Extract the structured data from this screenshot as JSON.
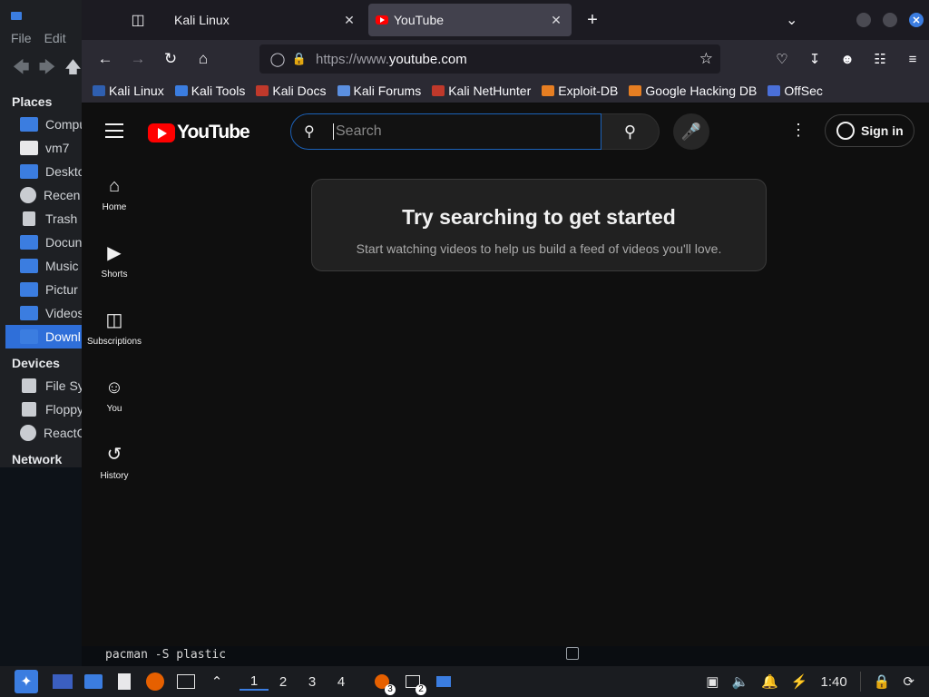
{
  "file_manager": {
    "menu": [
      "File",
      "Edit"
    ],
    "places_header": "Places",
    "places": [
      "Compu",
      "vm7",
      "Deskto",
      "Recen",
      "Trash",
      "Docun",
      "Music",
      "Pictur",
      "Videos",
      "Downl"
    ],
    "devices_header": "Devices",
    "devices": [
      "File Sy",
      "Floppy",
      "ReactO"
    ],
    "network_header": "Network"
  },
  "terminal": {
    "command": "pacman -S plastic"
  },
  "browser": {
    "tabs": [
      {
        "title": "Kali Linux",
        "active": false
      },
      {
        "title": "YouTube",
        "active": true
      }
    ],
    "url": {
      "prefix": "https://www.",
      "domain": "youtube.com"
    },
    "bookmarks": [
      {
        "label": "Kali Linux",
        "color": "#2f5fb0"
      },
      {
        "label": "Kali Tools",
        "color": "#3b7de0"
      },
      {
        "label": "Kali Docs",
        "color": "#c0392b"
      },
      {
        "label": "Kali Forums",
        "color": "#5b8fe0"
      },
      {
        "label": "Kali NetHunter",
        "color": "#c0392b"
      },
      {
        "label": "Exploit-DB",
        "color": "#e67e22"
      },
      {
        "label": "Google Hacking DB",
        "color": "#e67e22"
      },
      {
        "label": "OffSec",
        "color": "#4a6fd8"
      }
    ]
  },
  "youtube": {
    "logo_text": "YouTube",
    "search_placeholder": "Search",
    "sign_in": "Sign in",
    "guide": [
      {
        "label": "Home",
        "icon": "home-icon"
      },
      {
        "label": "Shorts",
        "icon": "shorts-icon"
      },
      {
        "label": "Subscriptions",
        "icon": "subscriptions-icon"
      },
      {
        "label": "You",
        "icon": "you-icon"
      },
      {
        "label": "History",
        "icon": "history-icon"
      }
    ],
    "prompt_title": "Try searching to get started",
    "prompt_body": "Start watching videos to help us build a feed of videos you'll love."
  },
  "taskbar": {
    "workspaces": [
      "1",
      "2",
      "3",
      "4"
    ],
    "badges": [
      "3",
      "2"
    ],
    "clock": "1:40"
  },
  "colors": {
    "accent": "#3b7de0",
    "youtube_red": "#ff0000",
    "page_bg": "#0f0f0f"
  }
}
